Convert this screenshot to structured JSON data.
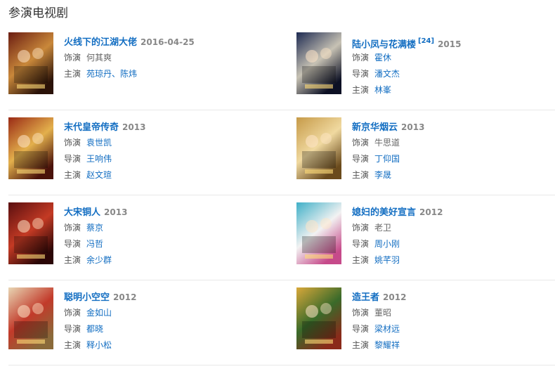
{
  "section_title": "参演电视剧",
  "sep": "、",
  "items": [
    {
      "title": "火线下的江湖大佬",
      "sup": "",
      "year": "2016-04-25",
      "lines": [
        {
          "k": "饰演",
          "v": [
            "何其爽"
          ],
          "link": false
        },
        {
          "k": "主演",
          "v": [
            "苑琼丹",
            "陈炜"
          ],
          "link": true
        }
      ],
      "poster": {
        "c1": "#6b1d12",
        "c2": "#c9883a",
        "c3": "#2a1208"
      }
    },
    {
      "title": "陆小凤与花满楼",
      "sup": "[24]",
      "year": "2015",
      "lines": [
        {
          "k": "饰演",
          "v": [
            "霍休"
          ],
          "link": true
        },
        {
          "k": "导演",
          "v": [
            "潘文杰"
          ],
          "link": true
        },
        {
          "k": "主演",
          "v": [
            "林峯"
          ],
          "link": true
        }
      ],
      "poster": {
        "c1": "#1d2a52",
        "c2": "#c7c2b4",
        "c3": "#0c1024"
      }
    },
    {
      "title": "末代皇帝传奇",
      "sup": "",
      "year": "2013",
      "lines": [
        {
          "k": "饰演",
          "v": [
            "袁世凯"
          ],
          "link": true
        },
        {
          "k": "导演",
          "v": [
            "王响伟"
          ],
          "link": true
        },
        {
          "k": "主演",
          "v": [
            "赵文瑄"
          ],
          "link": true
        }
      ],
      "poster": {
        "c1": "#9a2a15",
        "c2": "#e3b04c",
        "c3": "#4a120a"
      }
    },
    {
      "title": "新京华烟云",
      "sup": "",
      "year": "2013",
      "lines": [
        {
          "k": "饰演",
          "v": [
            "牛思道"
          ],
          "link": false
        },
        {
          "k": "导演",
          "v": [
            "丁仰国"
          ],
          "link": true
        },
        {
          "k": "主演",
          "v": [
            "李晟"
          ],
          "link": true
        }
      ],
      "poster": {
        "c1": "#c69a48",
        "c2": "#f0d9a0",
        "c3": "#6a4a1c"
      }
    },
    {
      "title": "大宋铜人",
      "sup": "",
      "year": "2013",
      "lines": [
        {
          "k": "饰演",
          "v": [
            "蔡京"
          ],
          "link": true
        },
        {
          "k": "导演",
          "v": [
            "冯哲"
          ],
          "link": true
        },
        {
          "k": "主演",
          "v": [
            "余少群"
          ],
          "link": true
        }
      ],
      "poster": {
        "c1": "#5a0f10",
        "c2": "#c43a24",
        "c3": "#2a0606"
      }
    },
    {
      "title": "媳妇的美好宣言",
      "sup": "",
      "year": "2012",
      "lines": [
        {
          "k": "饰演",
          "v": [
            "老卫"
          ],
          "link": false
        },
        {
          "k": "导演",
          "v": [
            "周小刚"
          ],
          "link": true
        },
        {
          "k": "主演",
          "v": [
            "姚芊羽"
          ],
          "link": true
        }
      ],
      "poster": {
        "c1": "#3fb0c8",
        "c2": "#f2f2f2",
        "c3": "#c64a8a"
      }
    },
    {
      "title": "聪明小空空",
      "sup": "",
      "year": "2012",
      "lines": [
        {
          "k": "饰演",
          "v": [
            "金如山"
          ],
          "link": true
        },
        {
          "k": "导演",
          "v": [
            "都晓"
          ],
          "link": true
        },
        {
          "k": "主演",
          "v": [
            "释小松"
          ],
          "link": true
        }
      ],
      "poster": {
        "c1": "#e8d6b4",
        "c2": "#c23a2a",
        "c3": "#8a6a3a"
      }
    },
    {
      "title": "造王者",
      "sup": "",
      "year": "2012",
      "lines": [
        {
          "k": "饰演",
          "v": [
            "董昭"
          ],
          "link": false
        },
        {
          "k": "导演",
          "v": [
            "梁材远"
          ],
          "link": true
        },
        {
          "k": "主演",
          "v": [
            "黎耀祥"
          ],
          "link": true
        }
      ],
      "poster": {
        "c1": "#d9a83a",
        "c2": "#3a6a2a",
        "c3": "#8a2a1a"
      }
    }
  ]
}
